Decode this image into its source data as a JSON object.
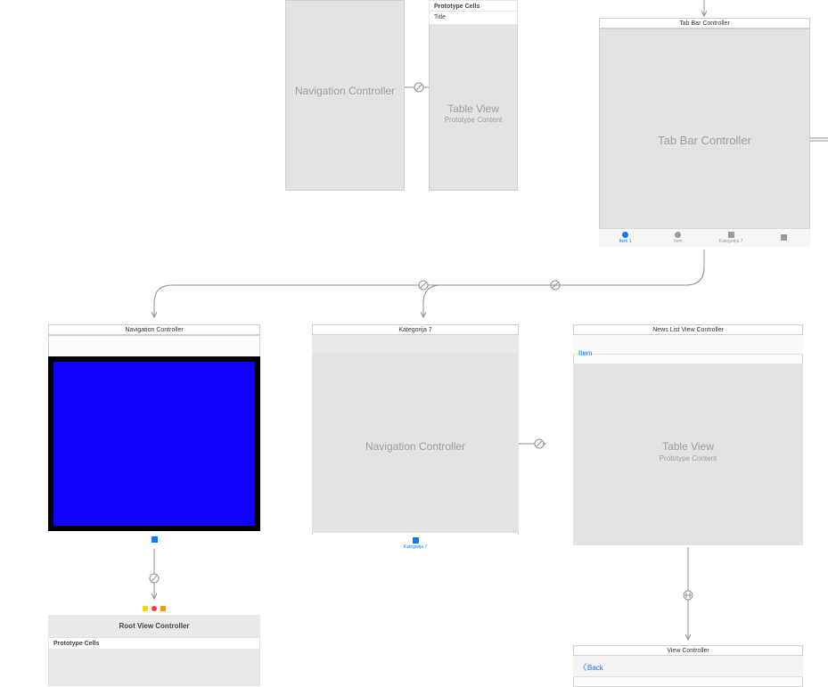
{
  "navA": {
    "title": "Navigation Controller",
    "content": "Navigation Controller"
  },
  "tableA": {
    "prototype": "Prototype Cells",
    "cell": "Title",
    "heading": "Table View",
    "sub": "Prototype Content"
  },
  "tabBar": {
    "title": "Tab Bar Controller",
    "content": "Tab Bar Controller",
    "items": [
      {
        "label": "Item 1",
        "shape": "cir",
        "active": true
      },
      {
        "label": "Item",
        "shape": "cir",
        "active": false
      },
      {
        "label": "Kategorija 7",
        "shape": "sq",
        "active": false
      },
      {
        "label": "",
        "shape": "sq",
        "active": false
      }
    ]
  },
  "navB": {
    "title": "Navigation Controller",
    "tabLabel": ""
  },
  "rootB": {
    "title": "Root View Controller",
    "prototype": "Prototype Cells"
  },
  "navC": {
    "title": "Kategorija 7",
    "content": "Navigation Controller",
    "tabLabel": "Kategorija 7"
  },
  "newsList": {
    "title": "News List View Controller",
    "item": "Item",
    "heading": "Table View",
    "sub": "Prototype Content"
  },
  "viewCtrl": {
    "title": "View Controller",
    "back": "Back"
  }
}
